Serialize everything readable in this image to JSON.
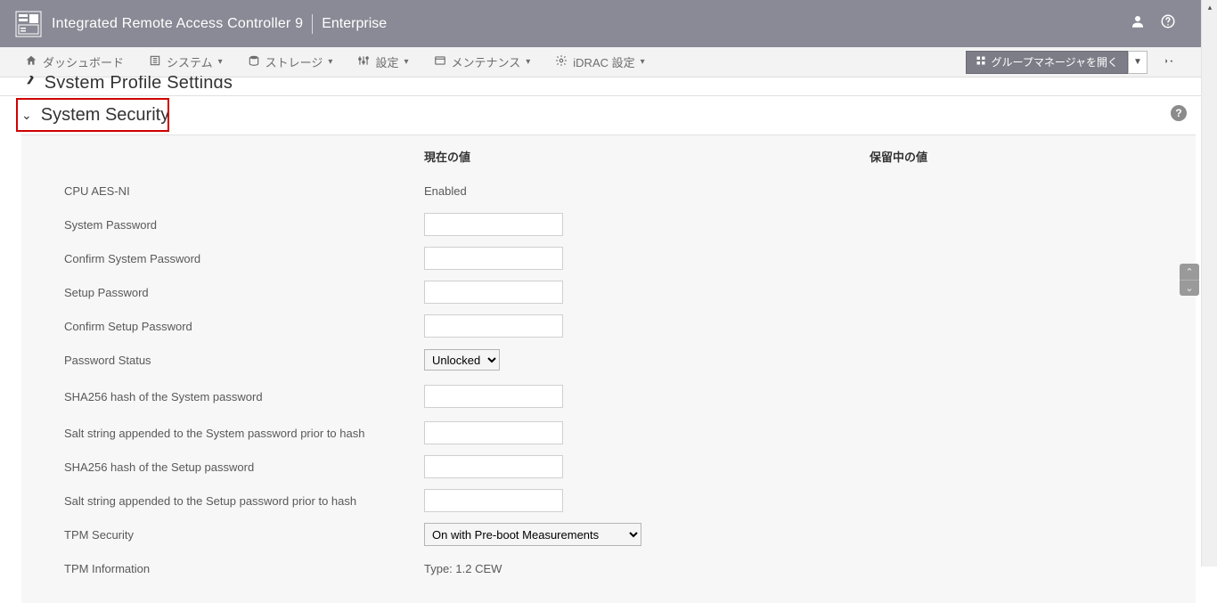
{
  "header": {
    "title": "Integrated Remote Access Controller 9",
    "edition": "Enterprise"
  },
  "nav": {
    "dashboard": "ダッシュボード",
    "system": "システム",
    "storage": "ストレージ",
    "configuration": "設定",
    "maintenance": "メンテナンス",
    "idrac_settings": "iDRAC 設定",
    "group_manager_open": "グループマネージャを開く"
  },
  "prev_section": "System Profile Settings",
  "section": {
    "title": "System Security",
    "col_current": "現在の値",
    "col_pending": "保留中の値"
  },
  "rows": {
    "cpu_aes_ni": {
      "label": "CPU AES-NI",
      "value": "Enabled"
    },
    "system_password": {
      "label": "System Password"
    },
    "confirm_system_password": {
      "label": "Confirm System Password"
    },
    "setup_password": {
      "label": "Setup Password"
    },
    "confirm_setup_password": {
      "label": "Confirm Setup Password"
    },
    "password_status": {
      "label": "Password Status",
      "value": "Unlocked"
    },
    "sha256_system": {
      "label": "SHA256 hash of the System password"
    },
    "salt_system": {
      "label": "Salt string appended to the System password prior to hash"
    },
    "sha256_setup": {
      "label": "SHA256 hash of the Setup password"
    },
    "salt_setup": {
      "label": "Salt string appended to the Setup password prior to hash"
    },
    "tpm_security": {
      "label": "TPM Security",
      "value": "On with Pre-boot Measurements"
    },
    "tpm_information": {
      "label": "TPM Information",
      "value": "Type: 1.2 CEW"
    }
  }
}
